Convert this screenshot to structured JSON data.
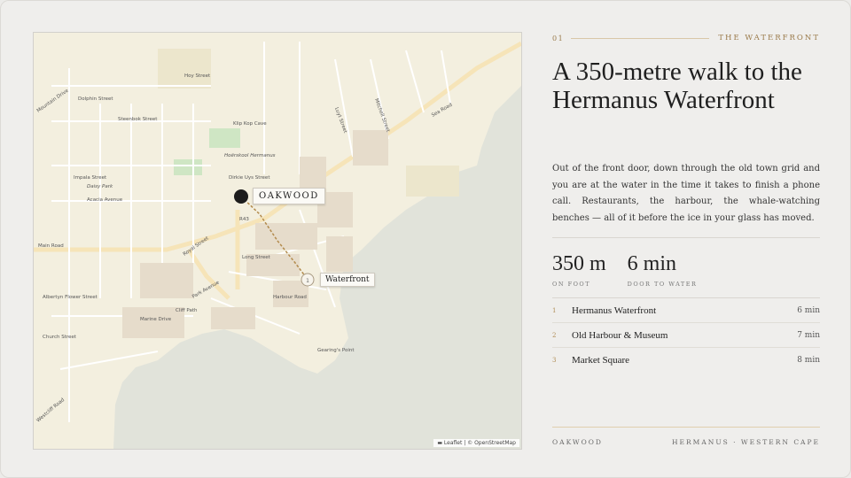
{
  "map": {
    "attribution": "▬ Leaflet | © OpenStreetMap",
    "markers": {
      "oakwood": "OAKWOOD",
      "waterfront": "Waterfront",
      "waterfront_num": "1"
    },
    "streets": {
      "main_road": "Main Road",
      "r43": "R43",
      "royal_street": "Royal Street",
      "long_street": "Long Street",
      "park_avenue": "Park Avenue",
      "marine_drive": "Marine Drive",
      "harbour_road": "Harbour Road",
      "hoy_street": "Hoy Street",
      "dolphin_street": "Dolphin Street",
      "steenbok_street": "Steenbok Street",
      "mountain_drive": "Mountain Drive",
      "impala_street": "Impala Street",
      "acacia_avenue": "Acacia Avenue",
      "daisy_park": "Daisy Park",
      "klip_kop_cave": "Klip Kop Cave",
      "hoerskool": "Hoërskool Hermanus",
      "dirkie_uys": "Dirkie Uys Street",
      "mitchell_street": "Mitchell Street",
      "luyt_street": "Luyt Street",
      "sea_road": "Sea Road",
      "cliff_path": "Cliff Path",
      "church_street": "Church Street",
      "albertyn_flower": "Albertyn Flower Street",
      "westcliff_road": "Westcliff Road",
      "gearing_point": "Gearing's Point"
    }
  },
  "panel": {
    "number": "01",
    "section": "THE WATERFRONT",
    "title": "A 350-metre walk to the Hermanus Waterfront",
    "body": "Out of the front door, down through the old town grid and you are at the water in the time it takes to finish a phone call. Restaurants, the harbour, the whale-watching benches — all of it before the ice in your glass has moved.",
    "stats": [
      {
        "value": "350 m",
        "label": "ON FOOT"
      },
      {
        "value": "6 min",
        "label": "DOOR TO WATER"
      }
    ],
    "places": [
      {
        "num": "1",
        "name": "Hermanus Waterfront",
        "time": "6 min"
      },
      {
        "num": "2",
        "name": "Old Harbour & Museum",
        "time": "7 min"
      },
      {
        "num": "3",
        "name": "Market Square",
        "time": "8 min"
      }
    ],
    "footer_left": "OAKWOOD",
    "footer_right": "HERMANUS · WESTERN CAPE"
  }
}
